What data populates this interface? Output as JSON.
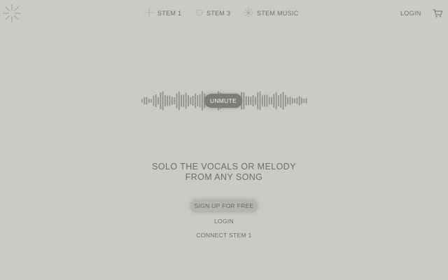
{
  "header": {
    "nav": [
      {
        "label": "STEM 1",
        "icon": "sparkle-cross-icon"
      },
      {
        "label": "STEM 3",
        "icon": "circle-dots-icon"
      },
      {
        "label": "STEM MUSIC",
        "icon": "starburst-icon"
      }
    ],
    "login_label": "LOGIN",
    "cart_icon": "cart-icon"
  },
  "player": {
    "unmute_label": "UNMUTE"
  },
  "hero": {
    "headline_line1": "SOLO THE VOCALS OR MELODY",
    "headline_line2": "FROM ANY SONG",
    "signup_label": "SIGN UP FOR FREE",
    "login_label": "LOGIN",
    "connect_label": "CONNECT STEM 1"
  },
  "colors": {
    "background": "#c8ccc4",
    "text": "#6c6f68",
    "waveform": "#8f928a",
    "unmute_bg": "#7b7e77"
  }
}
